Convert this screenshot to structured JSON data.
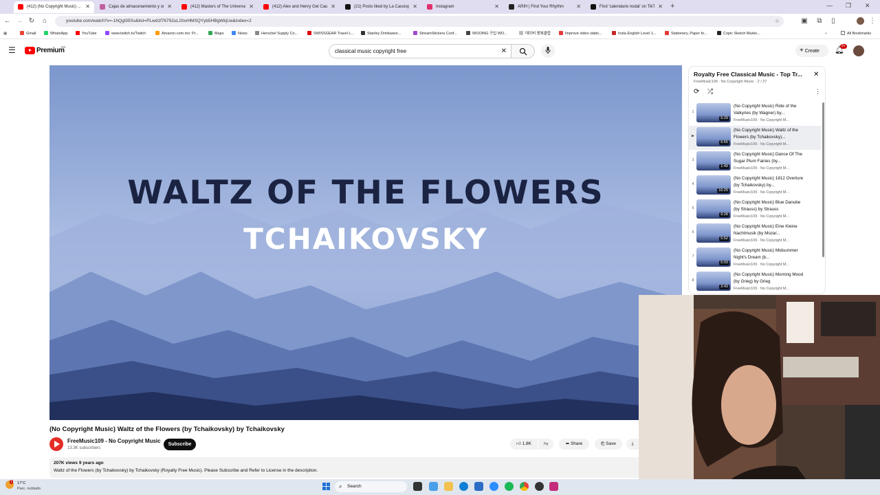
{
  "browser": {
    "tabs": [
      {
        "title": "(412) (No Copyright Music) ...",
        "fav": "#ff0000",
        "active": true
      },
      {
        "title": "Cajas de almacenamiento y org",
        "fav": "#c060a0"
      },
      {
        "title": "(412) Masters of The Universe",
        "fav": "#ff0000"
      },
      {
        "title": "(412) Alex and Henry Get Caug",
        "fav": "#ff0000"
      },
      {
        "title": "(21) Posts liked by La Cassiope",
        "fav": "#111111"
      },
      {
        "title": "Instagram",
        "fav": "#e1306c"
      },
      {
        "title": "ARIH | Find Your Rhythm",
        "fav": "#222222"
      },
      {
        "title": "Find 'calendario nodal' on TikTok",
        "fav": "#111111"
      }
    ],
    "url": "youtube.com/watch?v=-1hQgl35Ss&list=PLwd1f76792uL1foxHMSQYyb5HBgWkjUe&index=2",
    "bookmarks": [
      "Gmail",
      "WhatsApp",
      "YouTube",
      "www.twitch.tv/Twitch",
      "Amazon.com.mx: Pr...",
      "Maps",
      "News",
      "Herschel Supply Co...",
      "SWISSGEAR Travel L...",
      "Stanley Drinkware...",
      "StreamStickers Conf...",
      "WOOING 구입 WO...",
      "데이비 왕복클럽",
      "Improve video statis...",
      "Insta English Level 1...",
      "Stationery, Paper fo...",
      "Copic Sketch Marke..."
    ],
    "all_bookmarks": "All Bookmarks"
  },
  "yt": {
    "logo": "Premium",
    "region": "MX",
    "search_value": "classical music copyright free",
    "create_label": "Create",
    "notif_badge": "9+"
  },
  "player": {
    "line1": "WALTZ OF THE FLOWERS",
    "line2": "TCHAIKOVSKY"
  },
  "video": {
    "title": "(No Copyright Music) Waltz of the Flowers (by Tchaikovsky) by Tchaikovsky",
    "channel": "FreeMusic109 - No Copyright Music",
    "subscribers": "13.3K subscribers",
    "subscribe_label": "Subscribe",
    "likes": "1.8K",
    "share_label": "Share",
    "save_label": "Save",
    "views_age": "207K views  9 years ago",
    "description": "Waltz of the Flowers (by Tchaikovsky) by Tchaikovsky (Royalty Free Music). Please Subscribe and Refer to License in the description."
  },
  "playlist": {
    "title": "Royalty Free Classical Music - Top Tr...",
    "meta": "FreeMusic109 · No Copyright Music · 2 / 27",
    "items": [
      {
        "num": "1",
        "title": "(No Copyright Music) Ride of the Valkyries (by Wagner) by...",
        "channel": "FreeMusic109 · No Copyright M...",
        "dur": "5:29"
      },
      {
        "num": "▶",
        "title": "(No Copyright Music) Waltz of the Flowers (by Tchaikovsky)...",
        "channel": "FreeMusic109 · No Copyright M...",
        "dur": "6:55",
        "current": true
      },
      {
        "num": "3",
        "title": "(No Copyright Music) Dance Of The Sugar Plum Fairies (by...",
        "channel": "FreeMusic109 · No Copyright M...",
        "dur": "1:49"
      },
      {
        "num": "4",
        "title": "(No Copyright Music) 1812 Overture (by Tchaikovsky) by...",
        "channel": "FreeMusic109 · No Copyright M...",
        "dur": "16:25"
      },
      {
        "num": "5",
        "title": "(No Copyright Music) Blue Danube (by Strauss) by Strauss",
        "channel": "FreeMusic109 · No Copyright M...",
        "dur": "9:28"
      },
      {
        "num": "6",
        "title": "(No Copyright Music) Eine Kleine Nachtmusik (by Mozar...",
        "channel": "FreeMusic109 · No Copyright M...",
        "dur": "5:52"
      },
      {
        "num": "7",
        "title": "(No Copyright Music) Midsummer Night's Dream (b...",
        "channel": "FreeMusic109 · No Copyright M...",
        "dur": "5:03"
      },
      {
        "num": "8",
        "title": "(No Copyright Music) Morning Mood (by Grieg) by Grieg",
        "channel": "FreeMusic109 · No Copyright M...",
        "dur": "3:43"
      }
    ]
  },
  "taskbar": {
    "weather_temp": "17°C",
    "weather_desc": "Parc. nublado",
    "search_label": "Search"
  },
  "colors": {
    "accent": "#ff0000",
    "tabbar": "#e1ddf0"
  }
}
